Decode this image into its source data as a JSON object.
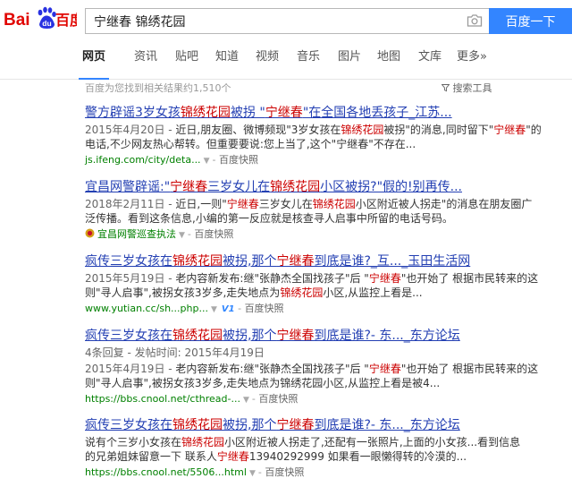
{
  "search": {
    "query": "宁继春 锦绣花园",
    "button_label": "百度一下"
  },
  "logo": {
    "text": "Bai百度",
    "pre": "Bai",
    "du": "du",
    "cn": "百度"
  },
  "tabs": [
    {
      "label": "网页",
      "active": true
    },
    {
      "label": "资讯"
    },
    {
      "label": "贴吧"
    },
    {
      "label": "知道"
    },
    {
      "label": "视频"
    },
    {
      "label": "音乐"
    },
    {
      "label": "图片"
    },
    {
      "label": "地图"
    },
    {
      "label": "文库"
    },
    {
      "label": "更多»"
    }
  ],
  "result_count": "百度为您找到相关结果约1,510个",
  "search_tools": "搜索工具",
  "search_tools_icon": "funnel-icon",
  "colors": {
    "link": "#2440b3",
    "highlight": "#cc0000",
    "url": "#008000",
    "accent": "#3385ff"
  },
  "results": [
    {
      "title": [
        "警方辟谣3岁女孩",
        "锦绣花园",
        "被拐 \"",
        "宁继春",
        "\"在全国各地丢孩子_江苏..."
      ],
      "date": "2015年4月20日 - ",
      "snippet_line1": [
        "近日,朋友圈、微博频现\"3岁女孩在",
        "锦绣花园",
        "被拐\"的消息,同时留下\"",
        "宁继春",
        "\"的"
      ],
      "snippet_line2": "电话,不少网友热心帮转。但重要要说:您上当了,这个\"宁继春\"不存在...",
      "url": "js.ifeng.com/city/deta...",
      "snapshot": "百度快照"
    },
    {
      "title": [
        "宜昌网警辟谣:\"",
        "宁继春",
        "三岁女儿在",
        "锦绣花园",
        "小区被拐?\"假的!别再传..."
      ],
      "date": "2018年2月11日 - ",
      "snippet_line1": [
        "近日,一则\"",
        "宁继春",
        "三岁女儿在",
        "锦绣花园",
        "小区附近被人拐走\"的消息在朋友圈广"
      ],
      "snippet_line2": "泛传播。看到这条信息,小编的第一反应就是核查寻人启事中所留的电话号码。",
      "url": "宜昌网警巡查执法",
      "snapshot": "百度快照"
    },
    {
      "title": [
        "疯传三岁女孩在",
        "锦绣花园",
        "被拐,那个",
        "宁继春",
        "到底是谁?_互..._玉田生活网"
      ],
      "date": "2015年5月19日 - ",
      "snippet_line1": [
        "老内容新发布:继\"张静杰全国找孩子\"后 \"",
        "宁继春",
        "\"也开始了 根据市民转来的这"
      ],
      "snippet_line2": [
        "则\"寻人启事\",被拐女孩3岁多,走失地点为",
        "锦绣花园",
        "小区,从监控上看是..."
      ],
      "url": "www.yutian.cc/sh...php...",
      "badge": "V1",
      "snapshot": "百度快照"
    },
    {
      "title": [
        "疯传三岁女孩在",
        "锦绣花园",
        "被拐,那个",
        "宁继春",
        "到底是谁?- 东..._东方论坛"
      ],
      "meta": "4条回复 - 发帖时间: 2015年4月19日",
      "date": "2015年4月19日 - ",
      "snippet_line1": [
        "老内容新发布:继\"张静杰全国找孩子\"后 \"",
        "宁继春",
        "\"也开始了 根据市民转来的这"
      ],
      "snippet_line2": "则\"寻人启事\",被拐女孩3岁多,走失地点为锦绣花园小区,从监控上看是被4...",
      "url": "https://bbs.cnool.net/cthread-...",
      "snapshot": "百度快照"
    },
    {
      "title": [
        "疯传三岁女孩在",
        "锦绣花园",
        "被拐,那个",
        "宁继春",
        "到底是谁?- 东..._东方论坛"
      ],
      "snippet_line1": [
        "说有个三岁小女孩在",
        "锦绣花园",
        "小区附近被人拐走了,还配有一张照片,上面的小女孩...看到信息"
      ],
      "snippet_line2": [
        "的兄弟姐妹留意一下 联系人",
        "宁继春",
        "13940292999 如果看一眼懒得转的冷漠的..."
      ],
      "url": "https://bbs.cnool.net/5506...html",
      "snapshot": "百度快照"
    }
  ]
}
